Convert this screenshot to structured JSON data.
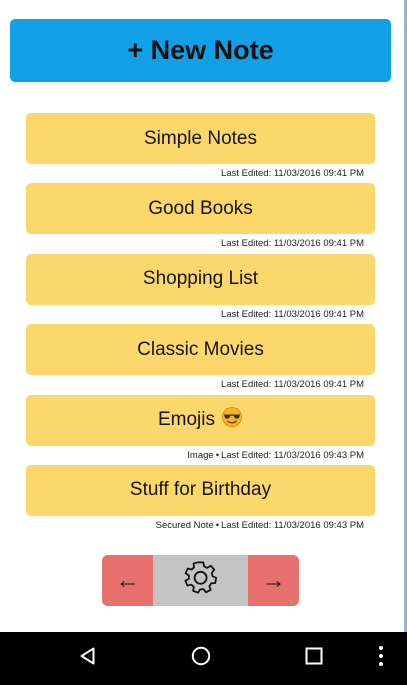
{
  "new_note_button": "+ New Note",
  "notes": [
    {
      "title": "Simple Notes",
      "tags": [],
      "last_edited": "Last Edited: 11/03/2016 09:41 PM"
    },
    {
      "title": "Good Books",
      "tags": [],
      "last_edited": "Last Edited: 11/03/2016 09:41 PM"
    },
    {
      "title": "Shopping List",
      "tags": [],
      "last_edited": "Last Edited: 11/03/2016 09:41 PM"
    },
    {
      "title": "Classic Movies",
      "tags": [],
      "last_edited": "Last Edited: 11/03/2016 09:41 PM"
    },
    {
      "title": "Emojis",
      "emoji": "sunglasses-face-icon",
      "tags": [
        "Image"
      ],
      "last_edited": "Last Edited: 11/03/2016 09:43 PM"
    },
    {
      "title": "Stuff for Birthday",
      "tags": [
        "Secured Note"
      ],
      "last_edited": "Last Edited: 11/03/2016 09:43 PM"
    }
  ],
  "meta_separator": "•",
  "pager": {
    "prev_label": "←",
    "next_label": "→",
    "settings_icon": "gear-icon"
  },
  "nav_bar": {
    "back_icon": "back-triangle-icon",
    "home_icon": "home-circle-icon",
    "recents_icon": "recents-square-icon",
    "menu_icon": "overflow-menu-icon"
  },
  "colors": {
    "new_note_bg": "#119fe5",
    "note_card_bg": "#fcd86c",
    "pager_arrow_bg": "#e8706e",
    "pager_settings_bg": "#c4c4c4",
    "nav_bar_bg": "#000000"
  }
}
